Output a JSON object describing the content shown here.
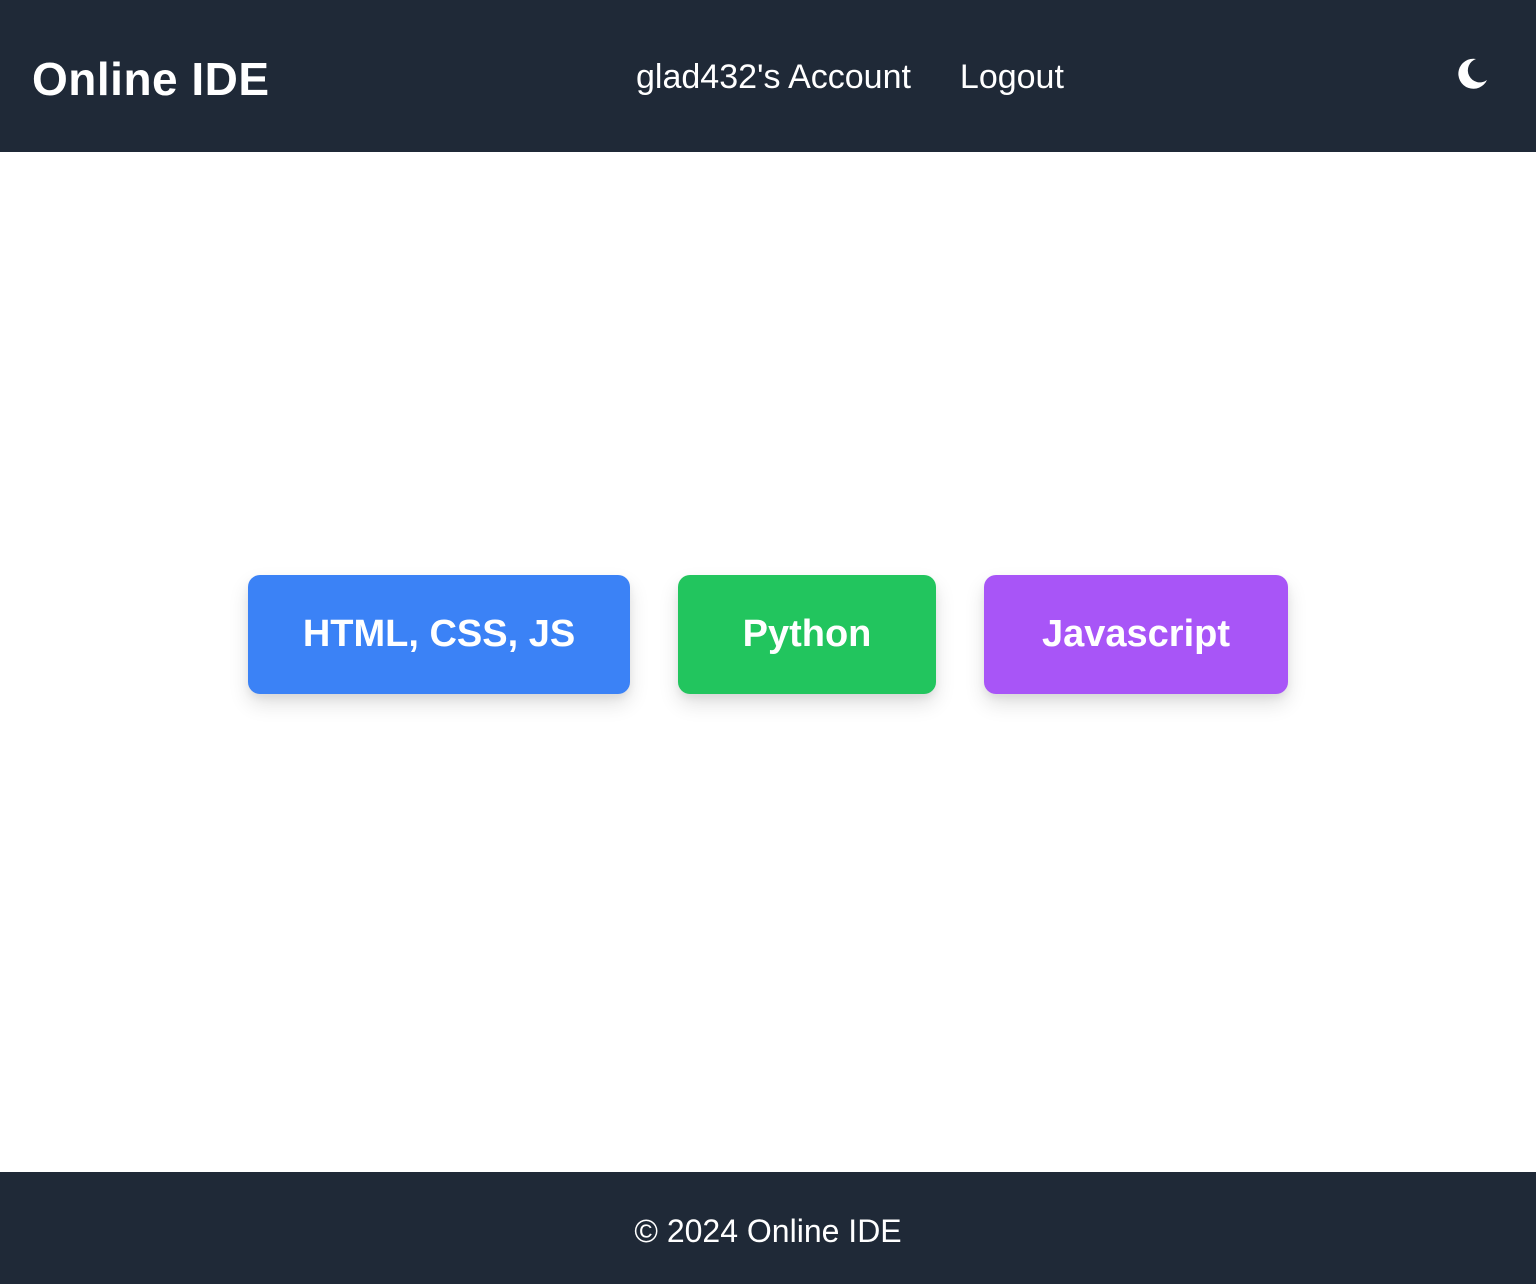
{
  "header": {
    "brand": "Online IDE",
    "nav": {
      "account_label": "glad432's Account",
      "logout_label": "Logout"
    },
    "theme_toggle_icon": "moon-icon"
  },
  "main": {
    "buttons": [
      {
        "label": "HTML, CSS, JS",
        "color": "#3b82f6"
      },
      {
        "label": "Python",
        "color": "#22c55e"
      },
      {
        "label": "Javascript",
        "color": "#a855f7"
      }
    ]
  },
  "footer": {
    "text": "© 2024 Online IDE"
  },
  "colors": {
    "nav_background": "#1f2937",
    "page_background": "#ffffff",
    "text_on_dark": "#ffffff"
  }
}
